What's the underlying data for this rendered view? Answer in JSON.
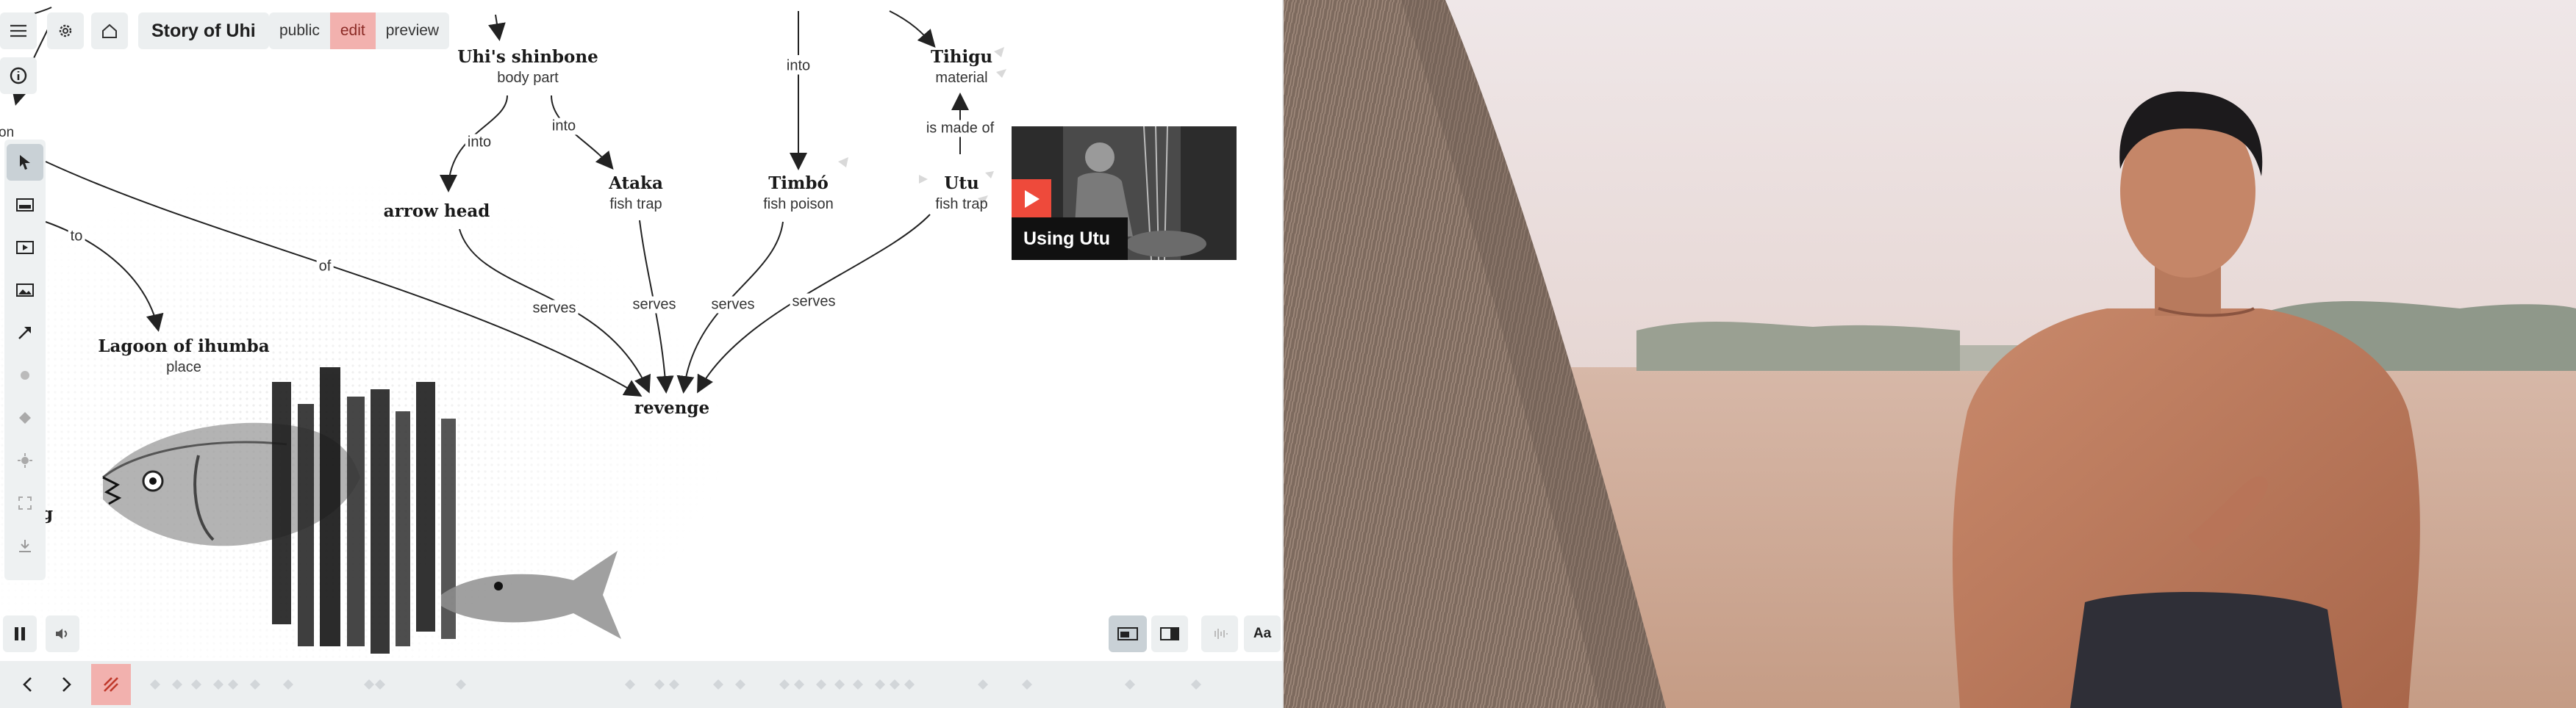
{
  "header": {
    "title": "Story of Uhi",
    "modes": [
      "public",
      "edit",
      "preview"
    ],
    "active_mode": "edit"
  },
  "graph": {
    "nodes": {
      "shinbone": {
        "title": "Uhi's shinbone",
        "sub": "body part"
      },
      "tihigu": {
        "title": "Tihigu",
        "sub": "material"
      },
      "arrowhead": {
        "title": "arrow head",
        "sub": ""
      },
      "ataka": {
        "title": "Ataka",
        "sub": "fish trap"
      },
      "timbo": {
        "title": "Timbó",
        "sub": "fish poison"
      },
      "utu": {
        "title": "Utu",
        "sub": "fish trap"
      },
      "lagoon": {
        "title": "Lagoon of ihumba",
        "sub": "place"
      },
      "revenge": {
        "title": "revenge",
        "sub": ""
      }
    },
    "edges": {
      "into_top": "into",
      "into_left": "into",
      "into_mid": "into",
      "is_made_of": "is made of",
      "to": "to",
      "of": "of",
      "serves1": "serves",
      "serves2": "serves",
      "serves3": "serves",
      "serves4": "serves"
    },
    "partial_labels": {
      "on": "on",
      "g": "g"
    }
  },
  "video_card": {
    "caption": "Using Utu"
  },
  "bottom": {
    "text_size_label": "Aa"
  },
  "icons": {
    "menu": "menu-icon",
    "settings": "gear-icon",
    "home": "home-icon",
    "info": "info-icon",
    "pointer": "pointer-icon",
    "card": "card-icon",
    "video": "video-icon",
    "image": "image-icon",
    "arrow": "arrow-icon",
    "download": "download-icon",
    "pause": "pause-icon",
    "volume": "volume-icon",
    "prev": "chevron-left-icon",
    "next": "chevron-right-icon"
  },
  "colors": {
    "accent": "#f2b1ae",
    "play": "#ee4a3b",
    "chrome": "#eceff0"
  }
}
